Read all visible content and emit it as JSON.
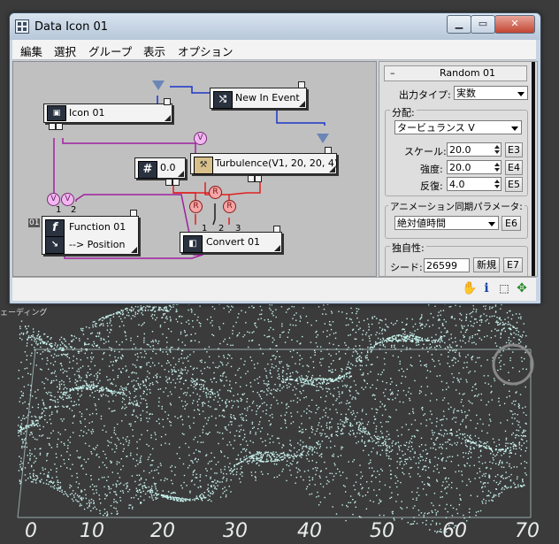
{
  "window": {
    "title": "Data Icon 01",
    "close": "✕",
    "minimize": "▁",
    "maximize": "▭"
  },
  "menu": [
    "編集",
    "選択",
    "グループ",
    "表示",
    "オプション"
  ],
  "graph": {
    "nodes": {
      "icon": "Icon 01",
      "new_event": "New In Event",
      "turbulence": "Turbulence(V1, 20, 20, 4)",
      "scalar": "0.0",
      "function_name": "Function 01",
      "function_target": "--> Position",
      "convert": "Convert 01",
      "function_index": "01"
    },
    "symbols": {
      "v": "V",
      "r": "R",
      "scalar_icon": "#",
      "function_icon": "f"
    },
    "port_numbers": {
      "fn_1": "1",
      "fn_2": "2",
      "cv_1": "1",
      "cv_2": "2",
      "cv_3": "3"
    }
  },
  "panel": {
    "rollout_title": "Random 01",
    "collapse": "–",
    "output_type_label": "出力タイプ:",
    "output_type_value": "実数",
    "distribution_label": "分配:",
    "distribution_value": "タービュランス V",
    "scale_label": "スケール:",
    "scale_value": "20.0",
    "scale_btn": "E3",
    "strength_label": "強度:",
    "strength_value": "20.0",
    "strength_btn": "E4",
    "iteration_label": "反復:",
    "iteration_value": "4.0",
    "iteration_btn": "E5",
    "anim_label": "アニメーション同期パラメータ:",
    "anim_value": "絶対値時間",
    "anim_btn": "E6",
    "unique_label": "独自性:",
    "seed_label": "シード:",
    "seed_value": "26599",
    "new_btn": "新規",
    "seed_btn": "E7"
  },
  "statusbar_icons": [
    "hand-icon",
    "info-icon",
    "region-select-icon",
    "move-arrows-icon"
  ],
  "viewport": {
    "label": "ェーディング",
    "axis_numbers": [
      "0",
      "10",
      "20",
      "30",
      "40",
      "50",
      "60",
      "70"
    ]
  },
  "colors": {
    "particles": "#c8f4ef",
    "purple_wire": "#a020a0",
    "red_wire": "#e02020",
    "blue_wire": "#1a35c8"
  }
}
